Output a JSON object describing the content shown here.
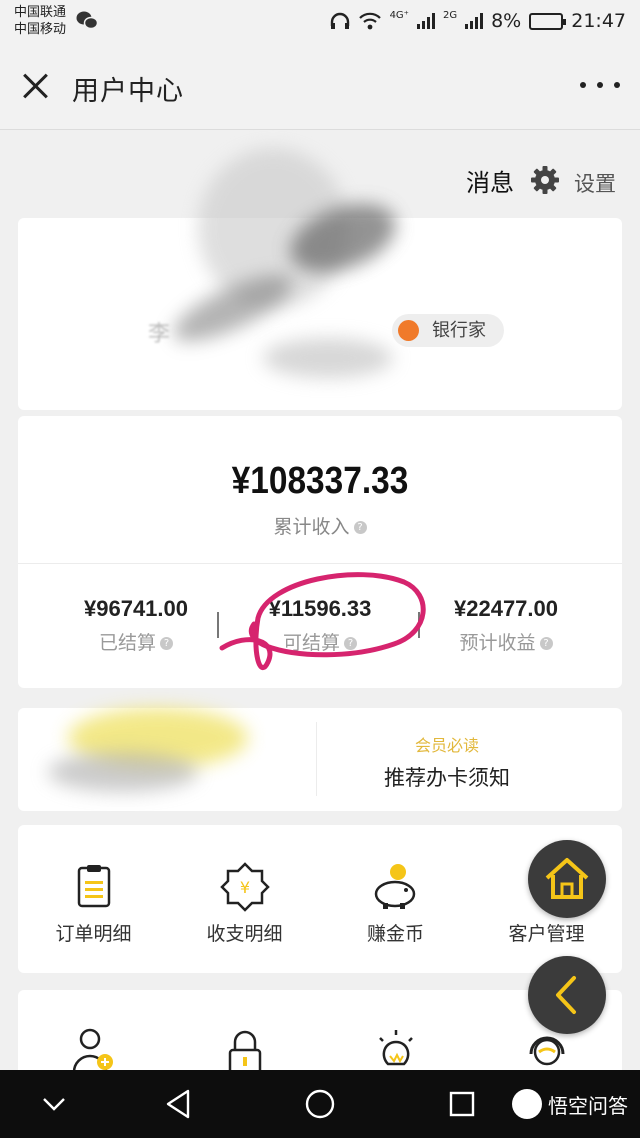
{
  "status_bar": {
    "carrier_1": "中国联通",
    "carrier_2": "中国移动",
    "network_1": "4G⁺",
    "network_2": "2G",
    "battery": "8%",
    "time": "21:47"
  },
  "nav": {
    "title": "用户中心"
  },
  "header": {
    "messages": "消息",
    "settings": "设置"
  },
  "profile": {
    "name": "李",
    "badge": "银行家"
  },
  "income": {
    "total_amount": "¥108337.33",
    "total_label": "累计收入",
    "stats": [
      {
        "amount": "¥96741.00",
        "label": "已结算"
      },
      {
        "amount": "¥11596.33",
        "label": "可结算"
      },
      {
        "amount": "¥22477.00",
        "label": "预计收益"
      }
    ]
  },
  "notice": {
    "tag": "会员必读",
    "title": "推荐办卡须知"
  },
  "menu": [
    {
      "label": "订单明细",
      "icon": "clipboard-icon"
    },
    {
      "label": "收支明细",
      "icon": "yen-badge-icon"
    },
    {
      "label": "赚金币",
      "icon": "piggy-bank-icon"
    },
    {
      "label": "客户管理",
      "icon": "customer-service-icon"
    }
  ],
  "menu_row2": [
    {
      "icon": "add-user-icon"
    },
    {
      "icon": "lock-icon"
    },
    {
      "icon": "lightbulb-icon"
    },
    {
      "icon": "headset-icon"
    }
  ],
  "watermark": "悟空问答",
  "colors": {
    "accent_yellow": "#f5c518",
    "tag_gold": "#e2b83c",
    "annotation_pink": "#d6246e",
    "fab_dark": "#3b3b3b"
  }
}
